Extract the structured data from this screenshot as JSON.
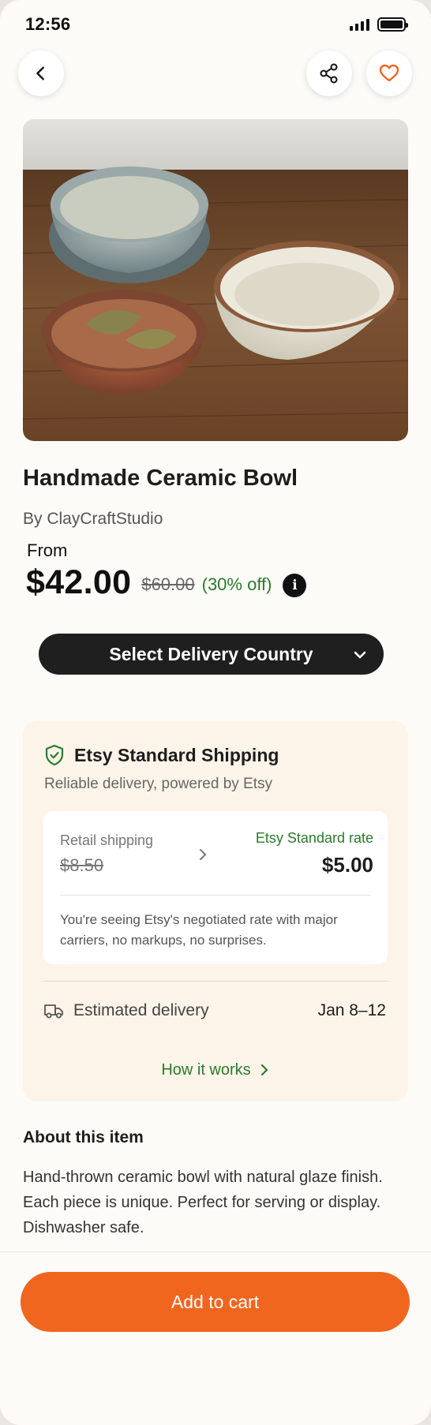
{
  "status_bar": {
    "time": "12:56"
  },
  "product": {
    "title": "Handmade Ceramic Bowl",
    "seller": "By ClayCraftStudio",
    "from_label": "From",
    "price": "$42.00",
    "original_price": "$60.00",
    "discount": "(30% off)",
    "info_glyph": "i"
  },
  "delivery_select": {
    "label": "Select Delivery Country"
  },
  "shipping": {
    "title": "Etsy Standard Shipping",
    "subtitle": "Reliable delivery, powered by Etsy",
    "retail_label": "Retail shipping",
    "retail_price": "$8.50",
    "etsy_rate_label": "Etsy Standard rate",
    "etsy_rate_price": "$5.00",
    "note": "You're seeing Etsy's negotiated rate with major carriers, no markups, no surprises.",
    "estimated_label": "Estimated delivery",
    "estimated_date": "Jan 8–12",
    "how_link": "How it works"
  },
  "about": {
    "title": "About this item",
    "text": "Hand-thrown ceramic bowl with natural glaze finish. Each piece is unique. Perfect for serving or display. Dishwasher safe."
  },
  "cart": {
    "label": "Add to cart"
  },
  "colors": {
    "accent": "#f0661f",
    "green": "#2a7a2a",
    "card_bg": "#fdf4e9",
    "dark_button": "#1f1f1f"
  },
  "icons": {
    "back": "chevron-left-icon",
    "share": "share-icon",
    "favorite": "heart-icon",
    "info": "info-icon",
    "select": "chevron-down-icon",
    "shield": "shield-check-icon",
    "truck": "truck-icon",
    "arrow": "chevron-right-icon"
  }
}
